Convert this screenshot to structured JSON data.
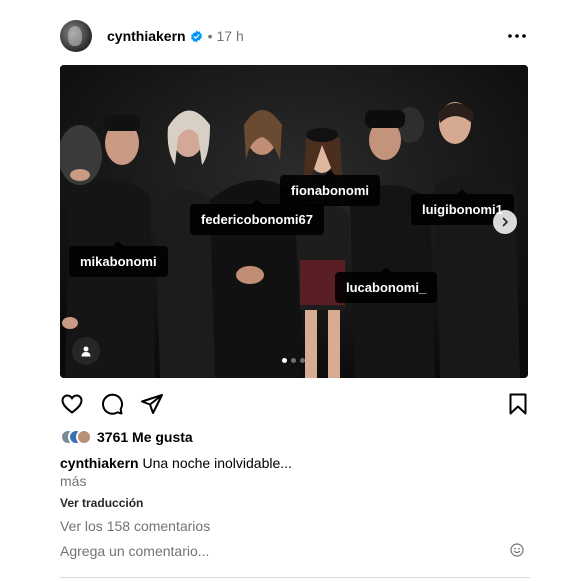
{
  "post": {
    "username": "cynthiakern",
    "dot": "•",
    "time": "17 h",
    "verified_color": "#0095f6",
    "more_icon": "more-horizontal-icon"
  },
  "photo": {
    "tags": [
      {
        "name": "fionabonomi"
      },
      {
        "name": "federicobonomi67"
      },
      {
        "name": "luigibonomi1"
      },
      {
        "name": "mikabonomi"
      },
      {
        "name": "lucabonomi_"
      }
    ],
    "carousel": {
      "current": 1,
      "total": 3
    }
  },
  "actions": {
    "like_icon": "heart-icon",
    "comment_icon": "comment-icon",
    "share_icon": "send-icon",
    "save_icon": "bookmark-icon"
  },
  "likes": {
    "count_text": "3761 Me gusta"
  },
  "caption": {
    "username": "cynthiakern",
    "text": "Una noche inolvidable...",
    "more": "más"
  },
  "translate_label": "Ver traducción",
  "comments_link": "Ver los 158 comentarios",
  "comment_input": {
    "placeholder": "Agrega un comentario..."
  }
}
